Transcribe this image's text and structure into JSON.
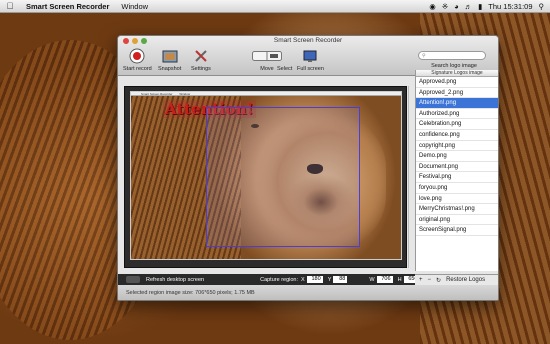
{
  "menubar": {
    "app_name": "Smart Screen Recorder",
    "menu_window": "Window",
    "clock": "Thu 15:31:09"
  },
  "window": {
    "title": "Smart Screen Recorder"
  },
  "toolbar": {
    "start_record": "Start record",
    "snapshot": "Snapshot",
    "settings": "Settings",
    "move": "Move",
    "select": "Select",
    "full_screen": "Full screen"
  },
  "search": {
    "placeholder": "",
    "label": "Search logo image"
  },
  "logo_list": {
    "header": "Signature Logos image",
    "items": [
      "Approved.png",
      "Approved_2.png",
      "Attention!.png",
      "Authorized.png",
      "Celebration.png",
      "confidence.png",
      "copyright.png",
      "Demo.png",
      "Document.png",
      "Festival.png",
      "foryou.png",
      "love.png",
      "MerryChristmas!.png",
      "original.png",
      "ScreenSignal.png"
    ],
    "selected_index": 2
  },
  "preview": {
    "inner_title": "Smart Screen Recorder",
    "inner_menu": "Window",
    "overlay_text": "Attention!"
  },
  "bottom": {
    "refresh": "Refresh desktop screen",
    "capture_label": "Capture region:",
    "x_label": "X",
    "x_val": "180",
    "y_label": "Y",
    "y_val": "88",
    "w_label": "W",
    "w_val": "706",
    "h_label": "H",
    "h_val": "650"
  },
  "right_bar": {
    "plus": "+",
    "minus": "−",
    "restore": "Restore Logos"
  },
  "status": {
    "text": "Selected region image size: 706*650 pixels;   1.75 MB"
  },
  "colors": {
    "selection_blue": "#3b74d6",
    "record_red": "#c8201a",
    "region_border": "#4a3dd8"
  }
}
